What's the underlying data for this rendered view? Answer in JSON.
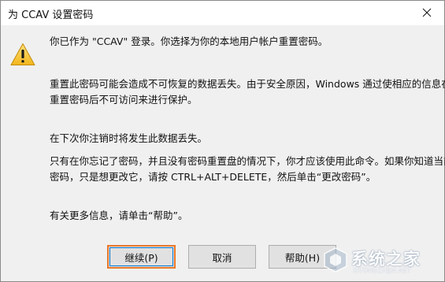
{
  "window": {
    "title": "为 CCAV 设置密码",
    "close_glyph": "✕"
  },
  "dialog": {
    "icon": "warning-icon",
    "lines": [
      "你已作为 \"CCAV\" 登录。你选择为你的本地用户帐户重置密码。",
      "重置此密码可能会造成不可恢复的数据丢失。由于安全原因，Windows 通过使相应的信息在",
      "重置密码后不可访问来进行保护。",
      "在下次你注销时将发生此数据丢失。",
      "只有在你忘记了密码，并且没有密码重置盘的情况下，你才应该使用此命令。如果你知道当前",
      "密码，只是想更改它，请按 CTRL+ALT+DELETE，然后单击“更改密码”。",
      "有关更多信息，请单击“帮助”。"
    ]
  },
  "buttons": {
    "continue": "继续(P)",
    "cancel": "取消",
    "help": "帮助(H)"
  },
  "watermark": {
    "text": "系统之家",
    "sub": "XITONGZHIJIA.NET"
  },
  "colors": {
    "accent_focus": "#e8792a",
    "focus_ring": "#0078d7",
    "dialog_bg": "#f0f0f0"
  }
}
